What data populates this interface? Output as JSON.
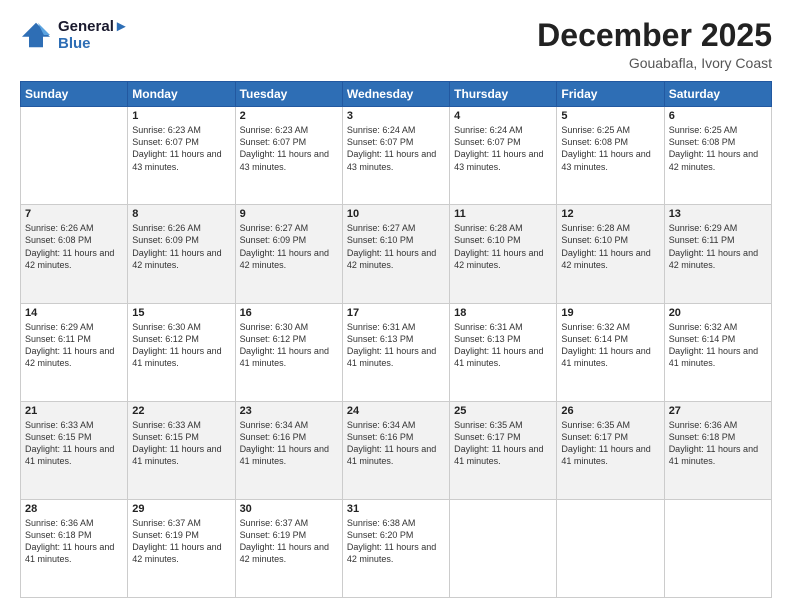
{
  "logo": {
    "line1": "General",
    "line2": "Blue"
  },
  "title": "December 2025",
  "subtitle": "Gouabafla, Ivory Coast",
  "headers": [
    "Sunday",
    "Monday",
    "Tuesday",
    "Wednesday",
    "Thursday",
    "Friday",
    "Saturday"
  ],
  "weeks": [
    {
      "days": [
        {
          "num": "",
          "info": ""
        },
        {
          "num": "1",
          "info": "Sunrise: 6:23 AM\nSunset: 6:07 PM\nDaylight: 11 hours\nand 43 minutes."
        },
        {
          "num": "2",
          "info": "Sunrise: 6:23 AM\nSunset: 6:07 PM\nDaylight: 11 hours\nand 43 minutes."
        },
        {
          "num": "3",
          "info": "Sunrise: 6:24 AM\nSunset: 6:07 PM\nDaylight: 11 hours\nand 43 minutes."
        },
        {
          "num": "4",
          "info": "Sunrise: 6:24 AM\nSunset: 6:07 PM\nDaylight: 11 hours\nand 43 minutes."
        },
        {
          "num": "5",
          "info": "Sunrise: 6:25 AM\nSunset: 6:08 PM\nDaylight: 11 hours\nand 43 minutes."
        },
        {
          "num": "6",
          "info": "Sunrise: 6:25 AM\nSunset: 6:08 PM\nDaylight: 11 hours\nand 42 minutes."
        }
      ]
    },
    {
      "days": [
        {
          "num": "7",
          "info": "Sunrise: 6:26 AM\nSunset: 6:08 PM\nDaylight: 11 hours\nand 42 minutes."
        },
        {
          "num": "8",
          "info": "Sunrise: 6:26 AM\nSunset: 6:09 PM\nDaylight: 11 hours\nand 42 minutes."
        },
        {
          "num": "9",
          "info": "Sunrise: 6:27 AM\nSunset: 6:09 PM\nDaylight: 11 hours\nand 42 minutes."
        },
        {
          "num": "10",
          "info": "Sunrise: 6:27 AM\nSunset: 6:10 PM\nDaylight: 11 hours\nand 42 minutes."
        },
        {
          "num": "11",
          "info": "Sunrise: 6:28 AM\nSunset: 6:10 PM\nDaylight: 11 hours\nand 42 minutes."
        },
        {
          "num": "12",
          "info": "Sunrise: 6:28 AM\nSunset: 6:10 PM\nDaylight: 11 hours\nand 42 minutes."
        },
        {
          "num": "13",
          "info": "Sunrise: 6:29 AM\nSunset: 6:11 PM\nDaylight: 11 hours\nand 42 minutes."
        }
      ]
    },
    {
      "days": [
        {
          "num": "14",
          "info": "Sunrise: 6:29 AM\nSunset: 6:11 PM\nDaylight: 11 hours\nand 42 minutes."
        },
        {
          "num": "15",
          "info": "Sunrise: 6:30 AM\nSunset: 6:12 PM\nDaylight: 11 hours\nand 41 minutes."
        },
        {
          "num": "16",
          "info": "Sunrise: 6:30 AM\nSunset: 6:12 PM\nDaylight: 11 hours\nand 41 minutes."
        },
        {
          "num": "17",
          "info": "Sunrise: 6:31 AM\nSunset: 6:13 PM\nDaylight: 11 hours\nand 41 minutes."
        },
        {
          "num": "18",
          "info": "Sunrise: 6:31 AM\nSunset: 6:13 PM\nDaylight: 11 hours\nand 41 minutes."
        },
        {
          "num": "19",
          "info": "Sunrise: 6:32 AM\nSunset: 6:14 PM\nDaylight: 11 hours\nand 41 minutes."
        },
        {
          "num": "20",
          "info": "Sunrise: 6:32 AM\nSunset: 6:14 PM\nDaylight: 11 hours\nand 41 minutes."
        }
      ]
    },
    {
      "days": [
        {
          "num": "21",
          "info": "Sunrise: 6:33 AM\nSunset: 6:15 PM\nDaylight: 11 hours\nand 41 minutes."
        },
        {
          "num": "22",
          "info": "Sunrise: 6:33 AM\nSunset: 6:15 PM\nDaylight: 11 hours\nand 41 minutes."
        },
        {
          "num": "23",
          "info": "Sunrise: 6:34 AM\nSunset: 6:16 PM\nDaylight: 11 hours\nand 41 minutes."
        },
        {
          "num": "24",
          "info": "Sunrise: 6:34 AM\nSunset: 6:16 PM\nDaylight: 11 hours\nand 41 minutes."
        },
        {
          "num": "25",
          "info": "Sunrise: 6:35 AM\nSunset: 6:17 PM\nDaylight: 11 hours\nand 41 minutes."
        },
        {
          "num": "26",
          "info": "Sunrise: 6:35 AM\nSunset: 6:17 PM\nDaylight: 11 hours\nand 41 minutes."
        },
        {
          "num": "27",
          "info": "Sunrise: 6:36 AM\nSunset: 6:18 PM\nDaylight: 11 hours\nand 41 minutes."
        }
      ]
    },
    {
      "days": [
        {
          "num": "28",
          "info": "Sunrise: 6:36 AM\nSunset: 6:18 PM\nDaylight: 11 hours\nand 41 minutes."
        },
        {
          "num": "29",
          "info": "Sunrise: 6:37 AM\nSunset: 6:19 PM\nDaylight: 11 hours\nand 42 minutes."
        },
        {
          "num": "30",
          "info": "Sunrise: 6:37 AM\nSunset: 6:19 PM\nDaylight: 11 hours\nand 42 minutes."
        },
        {
          "num": "31",
          "info": "Sunrise: 6:38 AM\nSunset: 6:20 PM\nDaylight: 11 hours\nand 42 minutes."
        },
        {
          "num": "",
          "info": ""
        },
        {
          "num": "",
          "info": ""
        },
        {
          "num": "",
          "info": ""
        }
      ]
    }
  ]
}
